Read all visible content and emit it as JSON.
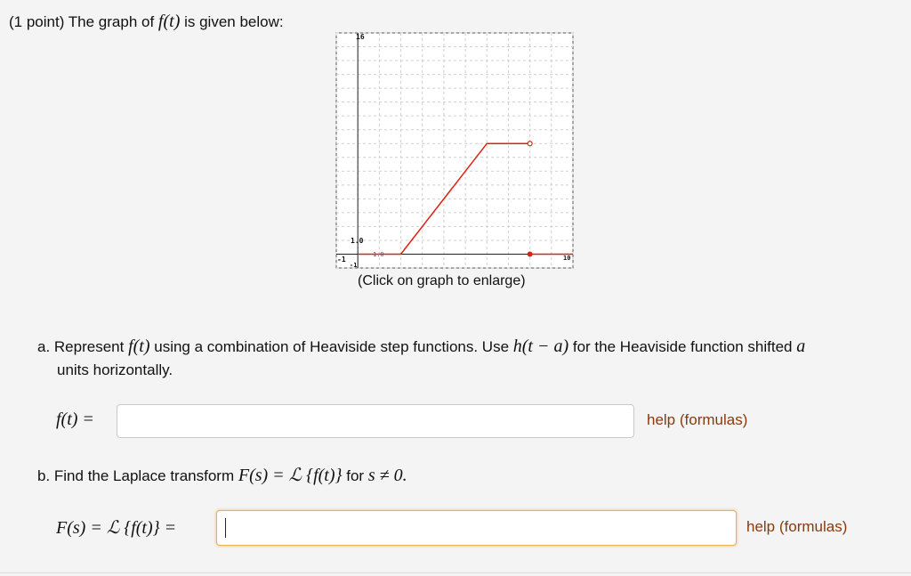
{
  "header": {
    "prefix": "(1 point) The graph of",
    "func": "f(t)",
    "suffix": "is given below:"
  },
  "graph": {
    "caption": "(Click on graph to enlarge)",
    "ticks": {
      "y_top": "16",
      "y_unit": "1.0",
      "x_unit": "1.0",
      "x_left": "-1",
      "y_bottom": "-1",
      "x_right": "10"
    },
    "colors": {
      "line": "#e02010",
      "grid": "#cfcfcf",
      "axis": "#222222"
    }
  },
  "chart_data": {
    "type": "line",
    "title": "",
    "xlabel": "",
    "ylabel": "",
    "xlim": [
      -1,
      10
    ],
    "ylim": [
      -1,
      16
    ],
    "grid": true,
    "series": [
      {
        "points": [
          [
            0,
            0
          ],
          [
            2,
            0
          ],
          [
            6,
            8
          ],
          [
            8,
            8
          ]
        ],
        "end_open": true
      },
      {
        "points": [
          [
            8,
            0
          ],
          [
            10,
            0
          ]
        ],
        "start_closed": true
      }
    ]
  },
  "part_a": {
    "t1": "a. Represent",
    "f": "f(t)",
    "t2": "using a combination of Heaviside step functions. Use",
    "h": "h(t − a)",
    "t3": "for the Heaviside function shifted",
    "a": "a",
    "t4": "units horizontally.",
    "label": "f(t) =",
    "value": "",
    "help": "help (formulas)"
  },
  "part_b": {
    "t1": "b. Find the Laplace transform",
    "expr": "F(s) = ℒ {f(t)}",
    "t2": "for",
    "cond": "s ≠ 0.",
    "label": "F(s) = ℒ {f(t)} =",
    "value": "",
    "help": "help (formulas)"
  }
}
